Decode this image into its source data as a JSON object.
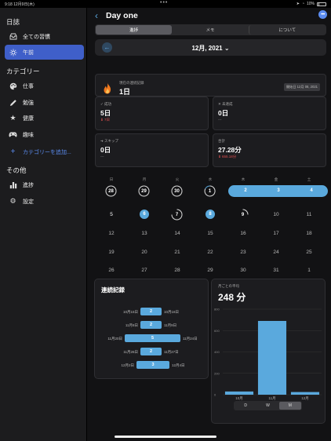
{
  "status": {
    "time": "9:18",
    "date": "12月9日(木)",
    "battery": "10%"
  },
  "sidebar": {
    "section_diary": "日誌",
    "items_top": [
      {
        "label": "全ての習慣",
        "icon": "tray-icon",
        "active": false
      },
      {
        "label": "午前",
        "icon": "sun-icon",
        "active": true
      }
    ],
    "section_category": "カテゴリー",
    "categories": [
      {
        "label": "仕事",
        "icon": "palette-icon"
      },
      {
        "label": "勉強",
        "icon": "pencil-icon"
      },
      {
        "label": "健康",
        "icon": "star-icon"
      },
      {
        "label": "趣味",
        "icon": "gamepad-icon"
      }
    ],
    "add_category": "カテゴリーを追加...",
    "section_other": "その他",
    "others": [
      {
        "label": "進捗",
        "icon": "chart-bar-icon"
      },
      {
        "label": "設定",
        "icon": "gear-icon"
      }
    ]
  },
  "header": {
    "title": "Day one"
  },
  "tabs": [
    {
      "label": "進捗",
      "active": true
    },
    {
      "label": "メモ",
      "active": false
    },
    {
      "label": "について",
      "active": false
    }
  ],
  "month_label": "12月, 2021",
  "streak_card": {
    "caption": "現在の連続記録",
    "value": "1日",
    "start_badge": "開始日 12月 08, 2021"
  },
  "stats": {
    "success": {
      "caption": "成功",
      "value": "5日",
      "sub": "7日"
    },
    "fail": {
      "caption": "未達成",
      "value": "0日",
      "sub": "---"
    },
    "skip": {
      "caption": "スキップ",
      "value": "0日",
      "sub": "---"
    },
    "total": {
      "caption": "合計",
      "value": "27.28分",
      "sub": "655.18分"
    }
  },
  "calendar": {
    "weekdays": [
      "日",
      "月",
      "火",
      "水",
      "木",
      "金",
      "土"
    ],
    "row1": [
      "28",
      "29",
      "30",
      "1",
      "2",
      "3",
      "4"
    ],
    "row2": [
      "5",
      "6",
      "7",
      "8",
      "9",
      "10",
      "11"
    ],
    "row3": [
      "12",
      "13",
      "14",
      "15",
      "16",
      "17",
      "18"
    ],
    "row4": [
      "19",
      "20",
      "21",
      "22",
      "23",
      "24",
      "25"
    ],
    "row5": [
      "26",
      "27",
      "28",
      "29",
      "30",
      "31",
      "1"
    ]
  },
  "streaks": {
    "title": "連続記録",
    "rows": [
      {
        "start": "10月15日",
        "count": "2",
        "end": "10月16日"
      },
      {
        "start": "11月8日",
        "count": "2",
        "end": "11月9日"
      },
      {
        "start": "11月20日",
        "count": "5",
        "end": "11月24日"
      },
      {
        "start": "11月26日",
        "count": "2",
        "end": "11月27日"
      },
      {
        "start": "12月2日",
        "count": "3",
        "end": "12月4日"
      }
    ]
  },
  "chart_data": {
    "type": "bar",
    "title": "月ごとの平均",
    "headline": "248 分",
    "categories": [
      "10月",
      "11月",
      "12月"
    ],
    "values": [
      30,
      690,
      25
    ],
    "ylim": [
      0,
      800
    ],
    "yticks": [
      "0",
      "200",
      "400",
      "600",
      "800"
    ],
    "bar_color": "#5aa9dd",
    "grid": true
  },
  "timeframe": [
    {
      "label": "D",
      "active": false
    },
    {
      "label": "W",
      "active": false
    },
    {
      "label": "M",
      "active": true
    }
  ]
}
